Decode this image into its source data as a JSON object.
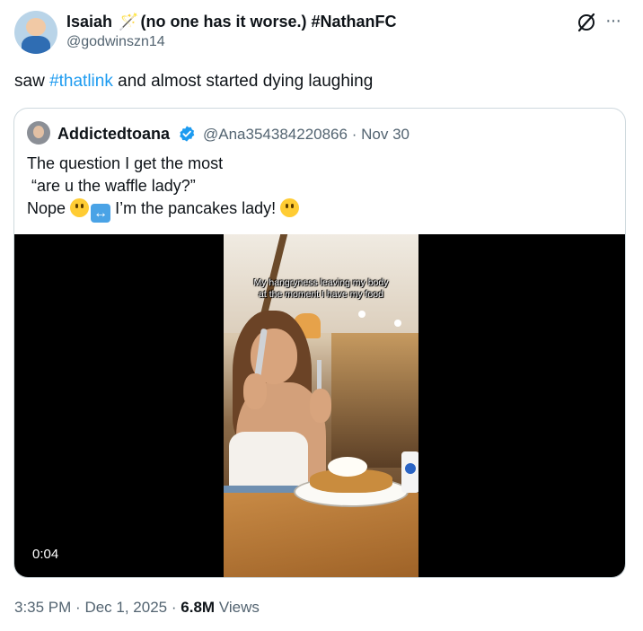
{
  "author": {
    "display_name": "Isaiah",
    "name_suffix": "(no one has it worse.) #NathanFC",
    "handle": "@godwinszn14"
  },
  "tweet": {
    "text_before": "saw ",
    "hashtag": "#thatlink",
    "text_after": " and almost started dying laughing"
  },
  "quoted_tweet": {
    "display_name": "Addictedtoana",
    "handle": "@Ana354384220866",
    "separator": "·",
    "date": "Nov 30",
    "lines": [
      "The question I get the most",
      " “are u the waffle lady?”",
      "Nope",
      "I’m the pancakes lady!"
    ],
    "video": {
      "caption": "My hangryness leaving my body\nat the moment I have my food",
      "duration": "0:04"
    }
  },
  "footer": {
    "time": "3:35 PM",
    "sep1": "·",
    "date": "Dec 1, 2025",
    "sep2": "·",
    "views_count": "6.8M",
    "views_label": "Views"
  },
  "icons": {
    "author_avatar": "avatar",
    "grok": "grok-icon",
    "more": "more-icon",
    "verified": "verified-badge-icon",
    "emoji": "slightly-smiling-face-emoji",
    "arrow": "left-right-arrow-emoji"
  },
  "colors": {
    "link": "#1d9bf0",
    "secondary_text": "#536471",
    "border": "#cfd9de",
    "verified": "#1d9bf0"
  }
}
